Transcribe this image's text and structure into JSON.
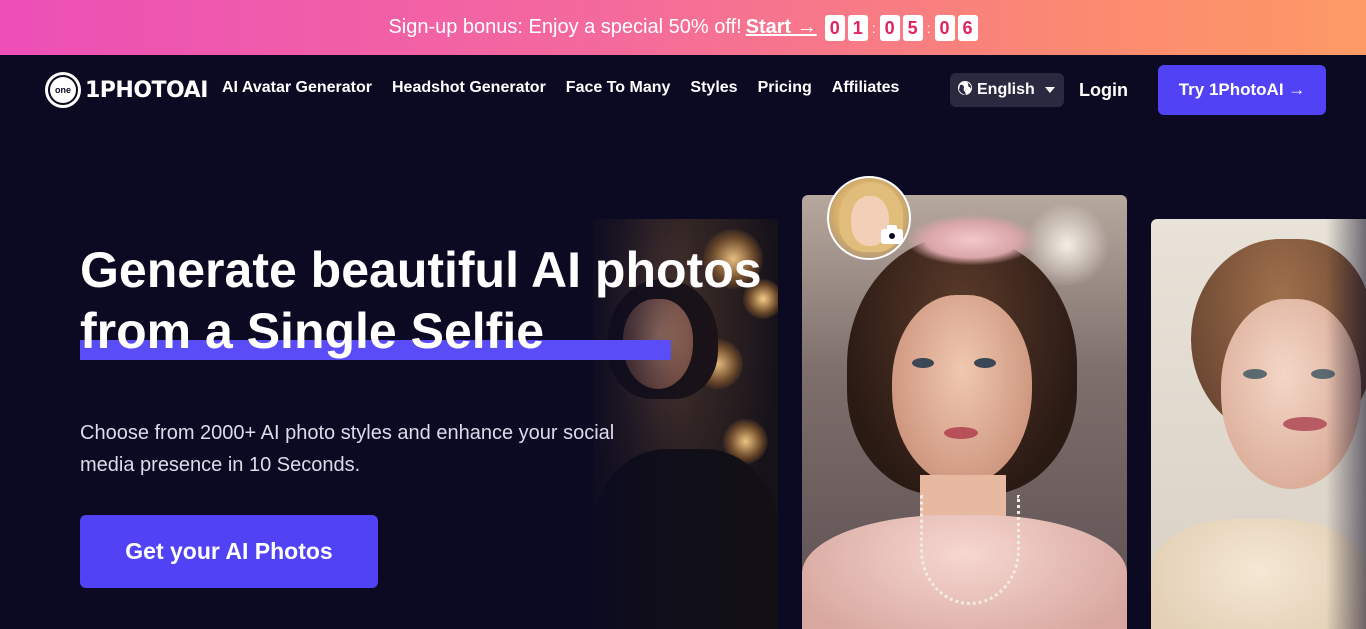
{
  "promo": {
    "message": "Sign-up bonus: Enjoy a special 50% off!",
    "start_label": "Start →",
    "timer": {
      "hours": [
        "0",
        "1"
      ],
      "minutes": [
        "0",
        "5"
      ],
      "seconds": [
        "0",
        "6"
      ],
      "separator": ":"
    }
  },
  "nav": {
    "logo_badge": "one",
    "logo_text": "1PHOTOAI",
    "links": [
      "AI Avatar Generator",
      "Headshot Generator",
      "Face To Many",
      "Styles",
      "Pricing",
      "Affiliates"
    ],
    "language": "English",
    "login_label": "Login",
    "try_label": "Try 1PhotoAI →"
  },
  "hero": {
    "title_line1": "Generate beautiful AI photos",
    "title_line2": "from a Single Selfie",
    "subtitle": "Choose from 2000+ AI photo styles and enhance your social media presence in 10 Seconds.",
    "cta_label": "Get your AI Photos"
  },
  "icons": {
    "globe": "globe-icon",
    "caret": "caret-down-icon",
    "camera": "camera-icon"
  },
  "colors": {
    "accent": "#5143f5",
    "background": "#0b0a22",
    "promo_gradient_start": "#ec4fb7",
    "promo_gradient_end": "#fd9a66"
  }
}
